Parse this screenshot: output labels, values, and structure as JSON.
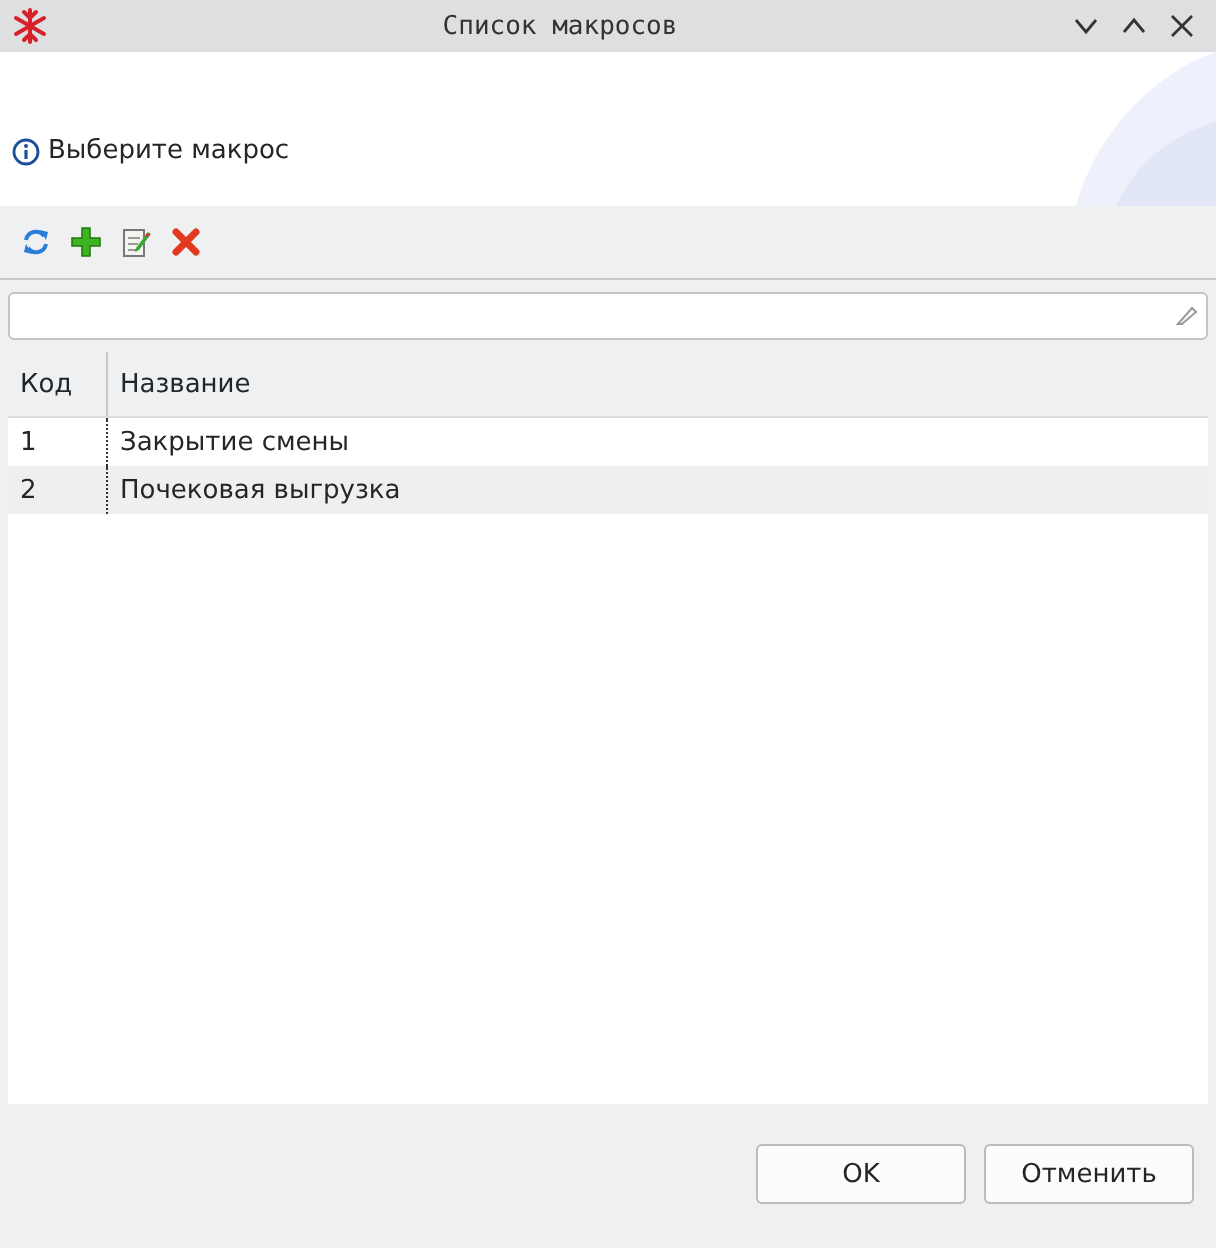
{
  "window": {
    "title": "Список макросов"
  },
  "header": {
    "message": "Выберите макрос"
  },
  "table": {
    "columns": [
      "Код",
      "Название"
    ],
    "rows": [
      {
        "code": "1",
        "name": "Закрытие смены"
      },
      {
        "code": "2",
        "name": "Почековая выгрузка"
      }
    ]
  },
  "buttons": [
    "OK",
    "Отменить"
  ]
}
